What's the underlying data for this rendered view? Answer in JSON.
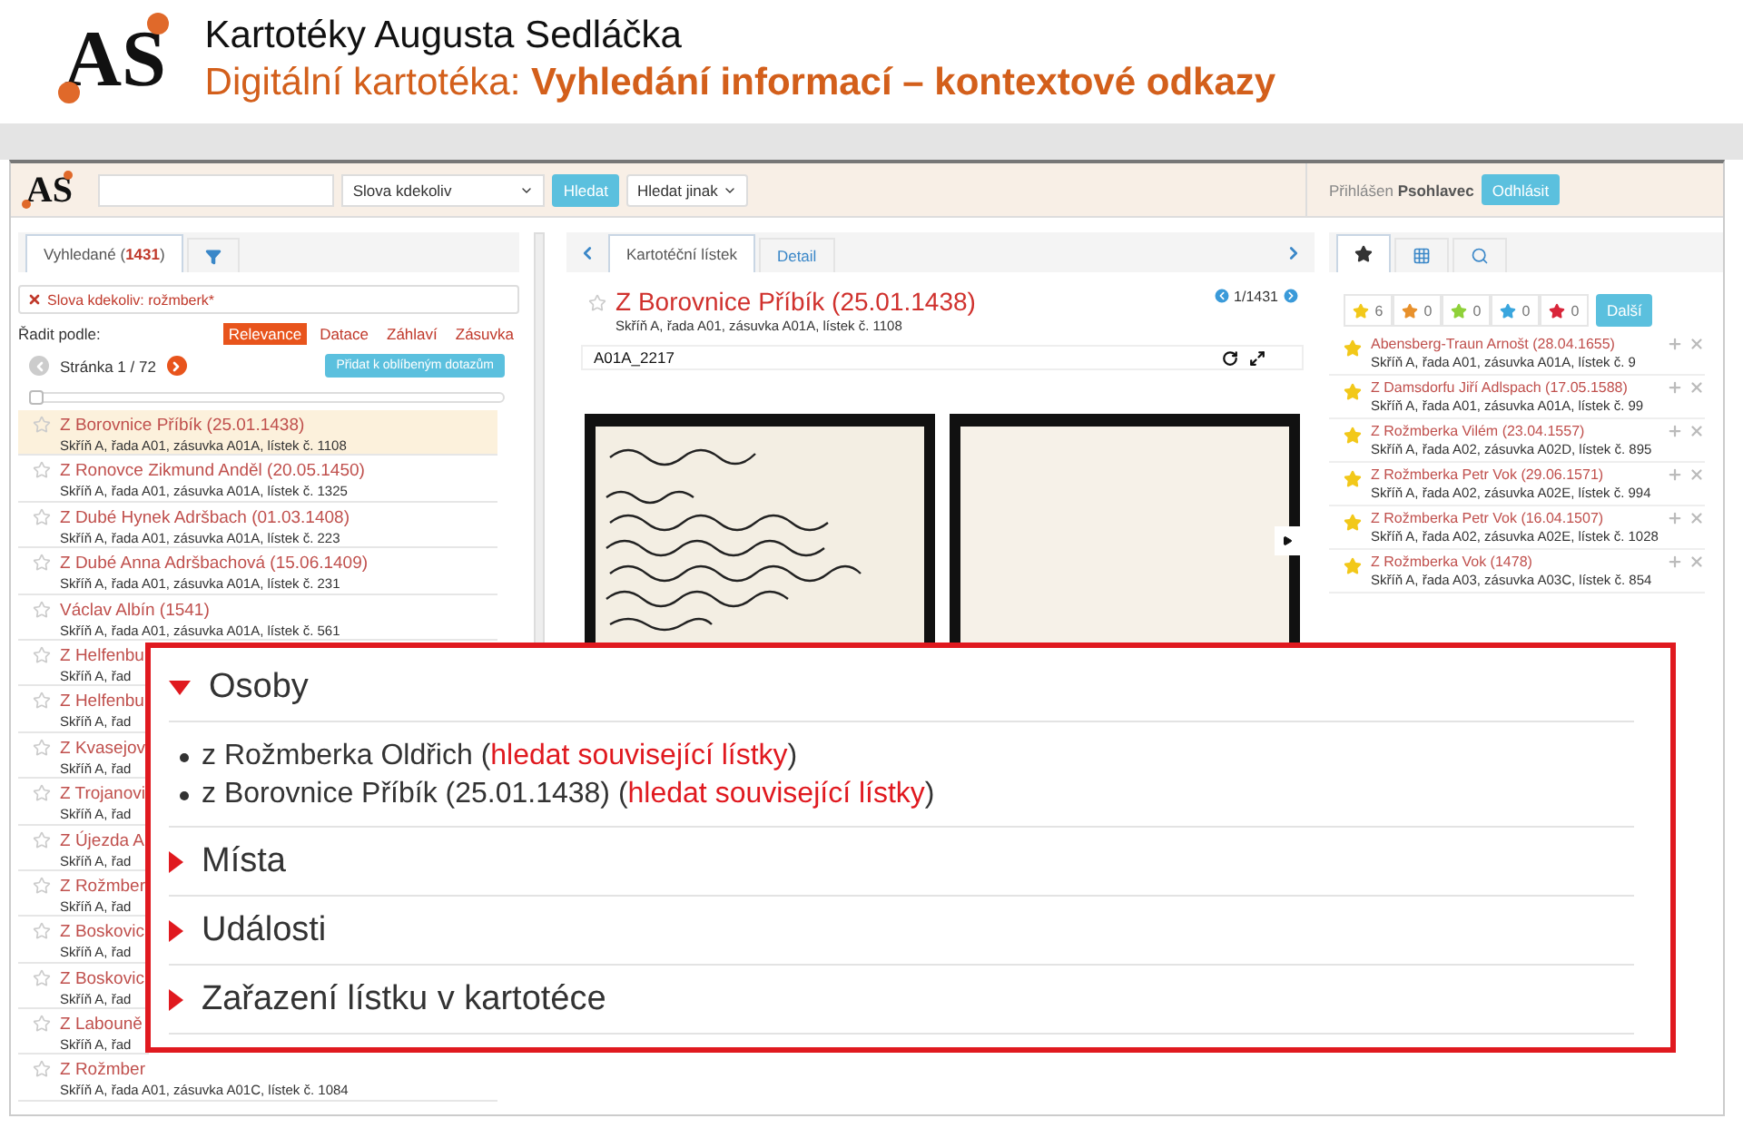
{
  "header": {
    "logo": "AS",
    "title": "Kartotéky Augusta Sedláčka",
    "subtitle": "Digitální kartotéka: **Vyhledání informací – kontextové odkazy**"
  },
  "navbar": {
    "logo": "AS",
    "search_scope": "Slova kdekoliv",
    "search_button": "Hledat",
    "other_search": "Hledat jinak",
    "login": "Přihlášen **Psohlavec**",
    "logout": "Odhlásit"
  },
  "left": {
    "tabs": [
      {
        "kind": "text",
        "label": "Vyhledané (**1431**)",
        "selected": true
      },
      {
        "kind": "filter",
        "selected": false
      }
    ],
    "filter_chip": "Slova kdekoliv: rožmberk*",
    "sort_label": "Řadit podle:",
    "sort_options": [
      {
        "label": "Relevance",
        "selected": true
      },
      {
        "label": "Datace",
        "selected": false
      },
      {
        "label": "Záhlaví",
        "selected": false
      },
      {
        "label": "Zásuvka",
        "selected": false
      }
    ],
    "page": "Stránka 1 / 72",
    "save_query": "Přidat k oblíbeným dotazům",
    "slider": {
      "level": 0
    },
    "results": [
      {
        "title": "Z Borovnice Příbík (25.01.1438)",
        "location": "Skříň A, řada A01, zásuvka A01A, lístek č. 1108",
        "selected": true
      },
      {
        "title": "Z Ronovce Zikmund Anděl (20.05.1450)",
        "location": "Skříň A, řada A01, zásuvka A01A, lístek č. 1325",
        "selected": false
      },
      {
        "title": "Z Dubé Hynek Adršbach (01.03.1408)",
        "location": "Skříň A, řada A01, zásuvka A01A, lístek č. 223",
        "selected": false
      },
      {
        "title": "Z Dubé Anna Adršbachová (15.06.1409)",
        "location": "Skříň A, řada A01, zásuvka A01A, lístek č. 231",
        "selected": false
      },
      {
        "title": "Václav Albín (1541)",
        "location": "Skříň A, řada A01, zásuvka A01A, lístek č. 561",
        "selected": false
      },
      {
        "title": "Z Helfenbu",
        "location": "Skříň A, řad",
        "selected": false
      },
      {
        "title": "Z Helfenbu",
        "location": "Skříň A, řad",
        "selected": false
      },
      {
        "title": "Z Kvasejov",
        "location": "Skříň A, řad",
        "selected": false
      },
      {
        "title": "Z Trojanovi",
        "location": "Skříň A, řad",
        "selected": false
      },
      {
        "title": "Z Újezda A",
        "location": "Skříň A, řad",
        "selected": false
      },
      {
        "title": "Z Rožmber",
        "location": "Skříň A, řad",
        "selected": false
      },
      {
        "title": "Z Boskovic",
        "location": "Skříň A, řad",
        "selected": false
      },
      {
        "title": "Z Boskovic",
        "location": "Skříň A, řad",
        "selected": false
      },
      {
        "title": "Z Labouně",
        "location": "Skříň A, řad",
        "selected": false
      },
      {
        "title": "Z Rožmber",
        "location": "Skříň A, řada A01, zásuvka A01C, lístek č. 1084",
        "selected": false
      }
    ]
  },
  "middle": {
    "tabs": [
      {
        "label": "Kartotéční lístek",
        "selected": true
      },
      {
        "label": "Detail",
        "selected": false
      }
    ],
    "title": "Z Borovnice Příbík (25.01.1438)",
    "location": "Skříň A, řada A01, zásuvka A01A, lístek č. 1108",
    "counter": "1/1431",
    "image_code": "A01A_2217"
  },
  "right": {
    "tabs": [
      {
        "kind": "star",
        "selected": true
      },
      {
        "kind": "grid",
        "selected": false
      },
      {
        "kind": "search",
        "selected": false
      }
    ],
    "star_filters": [
      {
        "count": "6",
        "color": "#f2c81a"
      },
      {
        "count": "0",
        "color": "#e8912c"
      },
      {
        "count": "0",
        "color": "#8fd13a"
      },
      {
        "count": "0",
        "color": "#3aa6de"
      },
      {
        "count": "0",
        "color": "#d9263a"
      }
    ],
    "more": "Další",
    "favorites": [
      {
        "title": "Abensberg-Traun Arnošt (28.04.1655)",
        "location": "Skříň A, řada A01, zásuvka A01A, lístek č. 9"
      },
      {
        "title": "Z Damsdorfu Jiří Adlspach (17.05.1588)",
        "location": "Skříň A, řada A01, zásuvka A01A, lístek č. 99"
      },
      {
        "title": "Z Rožmberka Vilém (23.04.1557)",
        "location": "Skříň A, řada A02, zásuvka A02D, lístek č. 895"
      },
      {
        "title": "Z Rožmberka Petr Vok (29.06.1571)",
        "location": "Skříň A, řada A02, zásuvka A02E, lístek č. 994"
      },
      {
        "title": "Z Rožmberka Petr Vok (16.04.1507)",
        "location": "Skříň A, řada A02, zásuvka A02E, lístek č. 1028"
      },
      {
        "title": "Z Rožmberka Vok (1478)",
        "location": "Skříň A, řada A03, zásuvka A03C, lístek č. 854"
      }
    ]
  },
  "callout": {
    "sections": [
      {
        "title": "Osoby",
        "expanded": true,
        "items": [
          {
            "before": "z Rožmberka Oldřich (",
            "link": "hledat související lístky",
            "after": ")"
          },
          {
            "before": "z Borovnice Příbík (25.01.1438) (",
            "link": "hledat související lístky",
            "after": ")"
          }
        ]
      },
      {
        "title": "Místa",
        "expanded": false
      },
      {
        "title": "Události",
        "expanded": false
      },
      {
        "title": "Zařazení lístku v kartotéce",
        "expanded": false
      }
    ]
  }
}
